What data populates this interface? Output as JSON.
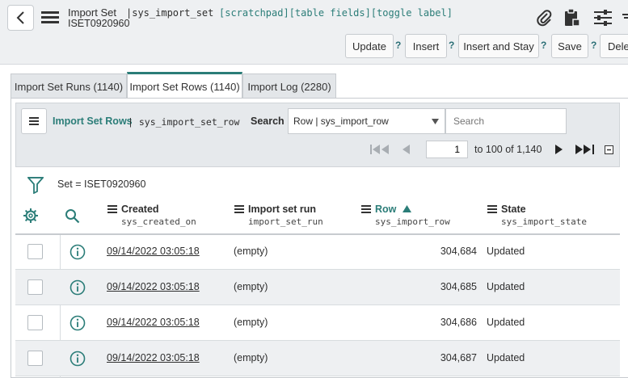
{
  "header": {
    "title": "Import Set",
    "record_number": "ISET0920960",
    "table_name": "|sys_import_set",
    "debug_links": "[scratchpad][table fields][toggle label]",
    "buttons": {
      "update": "Update",
      "insert": "Insert",
      "insert_and_stay": "Insert and Stay",
      "save": "Save",
      "delete": "Delete"
    },
    "help_mark": "?"
  },
  "tabs": [
    {
      "label": "Import Set Runs (1140)",
      "active": false
    },
    {
      "label": "Import Set Rows (1140)",
      "active": true
    },
    {
      "label": "Import Log (2280)",
      "active": false
    }
  ],
  "list": {
    "title": "Import Set Rows",
    "table": "| sys_import_set_row",
    "search_label": "Search",
    "search_field": "Row | sys_import_row",
    "search_placeholder": "Search",
    "page_current": "1",
    "page_range": "to 100 of 1,140",
    "filter_text": "Set = ISET0920960",
    "columns": [
      {
        "label": "Created",
        "field": "sys_created_on"
      },
      {
        "label": "Import set run",
        "field": "import_set_run"
      },
      {
        "label": "Row",
        "field": "sys_import_row",
        "sorted": "ascending"
      },
      {
        "label": "State",
        "field": "sys_import_state"
      }
    ],
    "rows": [
      {
        "created": "09/14/2022 03:05:18",
        "run": "(empty)",
        "row": "304,684",
        "state": "Updated"
      },
      {
        "created": "09/14/2022 03:05:18",
        "run": "(empty)",
        "row": "304,685",
        "state": "Updated"
      },
      {
        "created": "09/14/2022 03:05:18",
        "run": "(empty)",
        "row": "304,686",
        "state": "Updated"
      },
      {
        "created": "09/14/2022 03:05:18",
        "run": "(empty)",
        "row": "304,687",
        "state": "Updated"
      }
    ]
  },
  "colors": {
    "accent": "#2b7d78",
    "header_bg": "#eef0f2",
    "row_alt": "#eef0f2"
  }
}
